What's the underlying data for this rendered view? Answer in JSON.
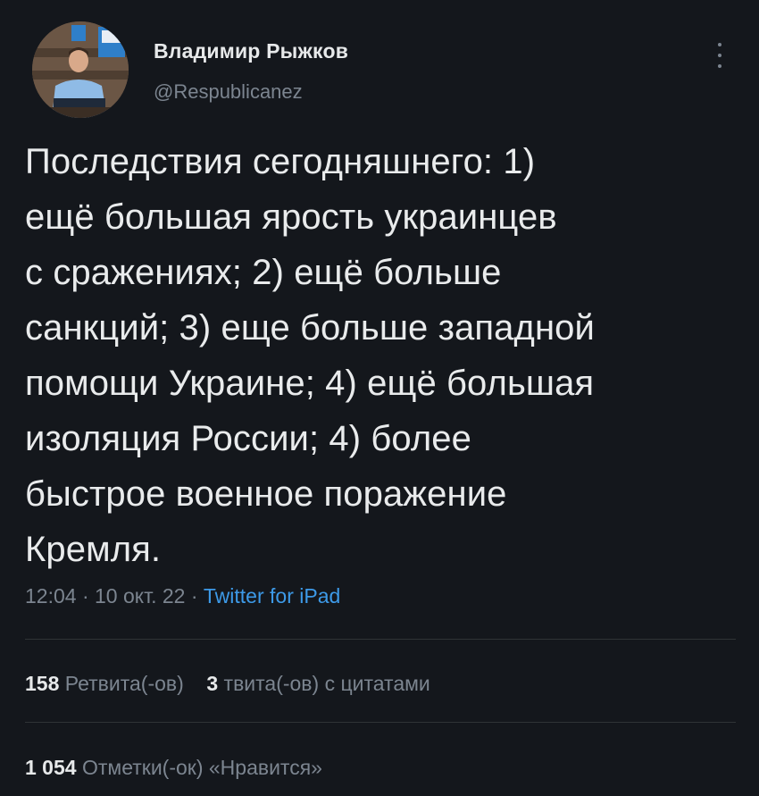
{
  "author": {
    "name": "Владимир Рыжков",
    "handle": "@Respublicanez"
  },
  "icons": {
    "more": "more-vertical-icon",
    "avatar": "profile-avatar"
  },
  "tweet": {
    "lines": [
      "Последствия сегодняшнего: 1)",
      "ещё большая ярость украинцев",
      "с сражениях; 2) ещё больше",
      "санкций; 3) еще больше западной",
      "помощи Украине; 4) ещё большая",
      "изоляция России; 4) более",
      "быстрое военное поражение",
      "Кремля."
    ]
  },
  "meta": {
    "time": "12:04",
    "separator1": " · ",
    "date": "10 окт. 22",
    "separator2": " · ",
    "source": "Twitter for iPad"
  },
  "stats": {
    "retweets_count": "158",
    "retweets_label": "Ретвита(-ов)",
    "quotes_count": "3",
    "quotes_label": "твита(-ов) с цитатами",
    "likes_count": "1 054",
    "likes_label": "Отметки(-ок) «Нравится»"
  },
  "colors": {
    "background": "#14171c",
    "text": "#e7e9ea",
    "secondary": "#7c8590",
    "link": "#3d9ae8",
    "divider": "#2f3336"
  }
}
